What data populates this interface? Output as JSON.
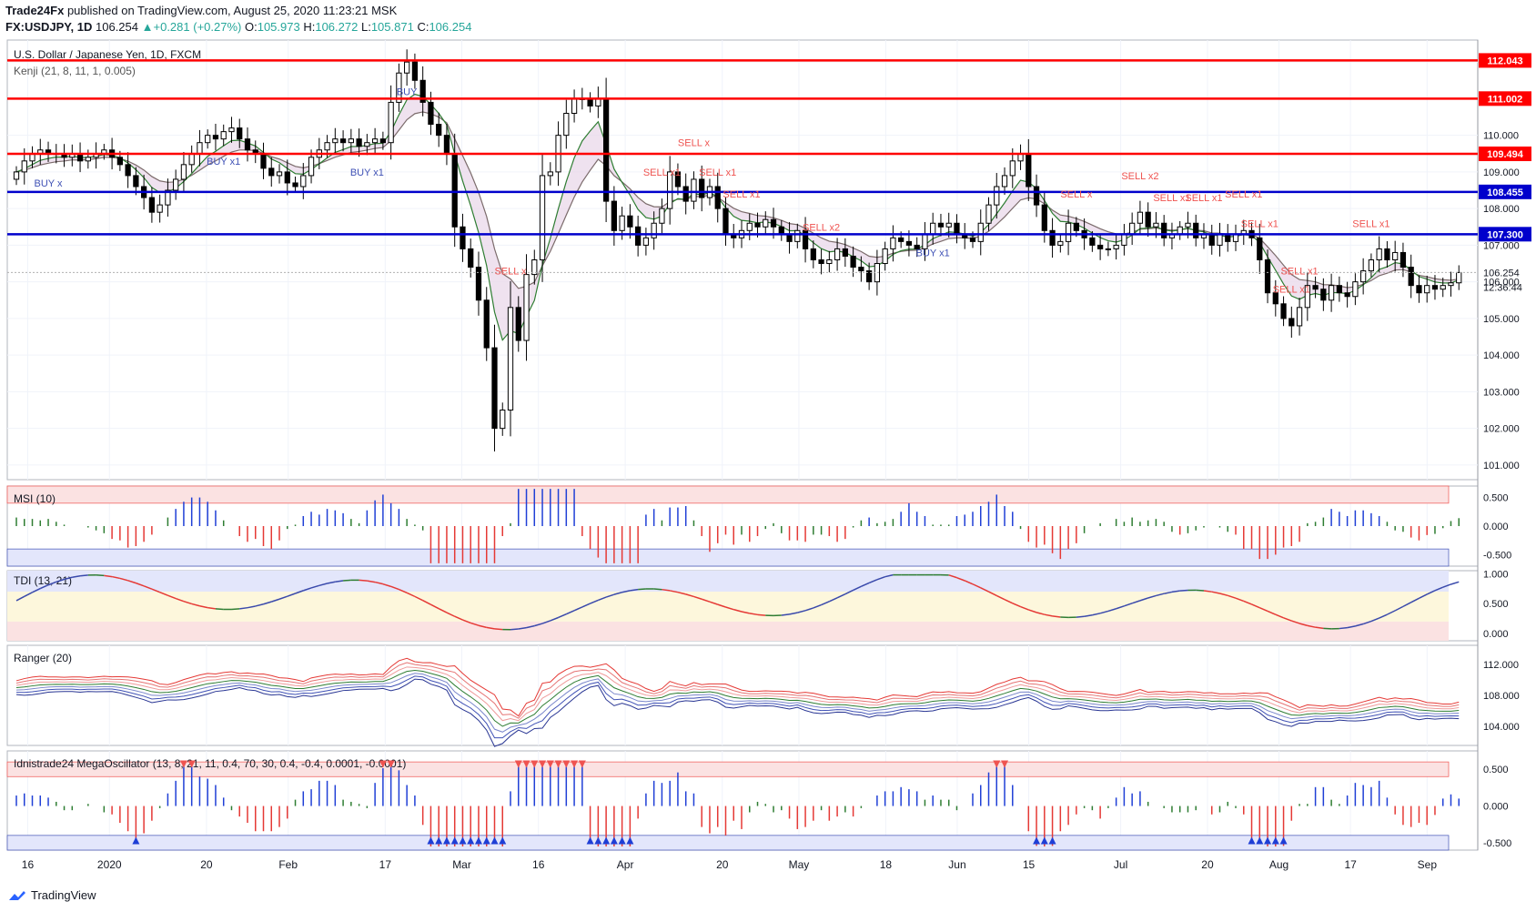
{
  "header": {
    "publisher": "Trade24Fx",
    "published_text": "published on TradingView.com, August 25, 2020 11:23:21 MSK",
    "symbol": "FX:USDJPY, 1D",
    "last": "106.254",
    "change": "+0.281 (+0.27%)",
    "o_label": "O:",
    "o": "105.973",
    "h_label": "H:",
    "h": "106.272",
    "l_label": "L:",
    "l": "105.871",
    "c_label": "C:",
    "c": "106.254"
  },
  "brand": "TradingView",
  "colors": {
    "bull": "#26a69a",
    "bear": "#ef5350",
    "red_level": "#ff0000",
    "blue_level": "#0000cc",
    "buy": "#3f51b5",
    "sell": "#ef5350"
  },
  "chart_data": [
    {
      "type": "candlestick",
      "title": "U.S. Dollar / Japanese Yen, 1D, FXCM",
      "subtitle": "Kenji (21, 8, 11, 1, 0.005)",
      "ylim": [
        100.6,
        112.6
      ],
      "y_ticks": [
        "112.000",
        "111.000",
        "110.000",
        "109.000",
        "108.000",
        "107.000",
        "106.000",
        "105.000",
        "104.000",
        "103.000",
        "102.000",
        "101.000"
      ],
      "y_tick_values": [
        112,
        111,
        110,
        109,
        108,
        107,
        106,
        105,
        104,
        103,
        102,
        101
      ],
      "x_ticks": [
        "16",
        "2020",
        "20",
        "Feb",
        "17",
        "Mar",
        "16",
        "Apr",
        "20",
        "May",
        "18",
        "Jun",
        "15",
        "Jul",
        "20",
        "Aug",
        "17",
        "Sep"
      ],
      "x_tick_days": [
        0,
        16,
        35,
        51,
        70,
        85,
        100,
        117,
        136,
        151,
        168,
        182,
        196,
        214,
        231,
        245,
        259,
        274
      ],
      "horizontal_levels": [
        {
          "value": 112.043,
          "label": "112.043",
          "color": "red"
        },
        {
          "value": 111.002,
          "label": "111.002",
          "color": "red"
        },
        {
          "value": 109.494,
          "label": "109.494",
          "color": "red"
        },
        {
          "value": 108.455,
          "label": "108.455",
          "color": "blue"
        },
        {
          "value": 107.3,
          "label": "107.300",
          "color": "blue"
        }
      ],
      "last_price": "106.254",
      "countdown": "12:36:44",
      "close_series": [
        109.0,
        109.3,
        109.5,
        109.6,
        109.5,
        109.5,
        109.4,
        109.5,
        109.3,
        109.4,
        109.5,
        109.6,
        109.4,
        109.2,
        108.9,
        108.6,
        108.3,
        107.9,
        108.1,
        108.5,
        108.8,
        109.2,
        109.5,
        109.8,
        110.0,
        109.9,
        110.1,
        110.2,
        109.9,
        109.6,
        109.5,
        109.1,
        108.9,
        109.0,
        108.7,
        108.6,
        108.9,
        109.4,
        109.6,
        109.8,
        109.9,
        109.8,
        109.9,
        109.7,
        109.8,
        109.9,
        109.8,
        110.9,
        111.7,
        112.0,
        111.5,
        110.9,
        110.3,
        110.0,
        109.5,
        107.5,
        106.9,
        106.4,
        105.5,
        104.2,
        102.0,
        102.5,
        105.3,
        104.4,
        106.2,
        106.6,
        108.9,
        109.0,
        110.0,
        110.6,
        111.0,
        111.0,
        110.8,
        111.0,
        108.2,
        107.4,
        107.8,
        107.5,
        107.0,
        107.2,
        107.6,
        108.0,
        109.0,
        108.6,
        108.2,
        108.8,
        108.3,
        108.6,
        108.0,
        107.3,
        107.2,
        107.4,
        107.6,
        107.5,
        107.7,
        107.5,
        107.3,
        107.1,
        107.4,
        106.9,
        106.6,
        106.5,
        106.6,
        106.9,
        106.7,
        106.4,
        106.3,
        106.0,
        106.5,
        106.9,
        107.2,
        107.1,
        107.0,
        106.9,
        107.3,
        107.6,
        107.5,
        107.6,
        107.3,
        107.2,
        107.1,
        107.6,
        108.1,
        108.6,
        108.9,
        109.3,
        109.5,
        108.6,
        108.1,
        107.4,
        107.0,
        107.1,
        107.6,
        107.4,
        107.2,
        107.0,
        106.9,
        106.9,
        107.0,
        107.3,
        107.6,
        107.9,
        107.5,
        107.6,
        107.2,
        107.3,
        107.5,
        107.6,
        107.2,
        107.3,
        107.0,
        107.3,
        107.1,
        107.3,
        107.4,
        107.2,
        106.6,
        105.7,
        105.4,
        105.0,
        104.8,
        105.3,
        105.9,
        105.8,
        105.5,
        105.9,
        105.7,
        105.6,
        106.0,
        106.3,
        106.6,
        106.9,
        106.6,
        106.8,
        106.4,
        105.9,
        105.7,
        105.9,
        105.8,
        105.9,
        105.973,
        106.254
      ]
    },
    {
      "type": "bar",
      "title": "MSI (10)",
      "ylim": [
        -0.7,
        0.7
      ],
      "y_ticks": [
        "0.500",
        "0.000",
        "-0.500"
      ],
      "y_tick_values": [
        0.5,
        0,
        -0.5
      ],
      "upper_band": [
        0.4,
        0.7
      ],
      "lower_band": [
        -0.7,
        -0.4
      ]
    },
    {
      "type": "line",
      "title": "TDI (13, 21)",
      "ylim": [
        -0.12,
        1.05
      ],
      "y_ticks": [
        "1.000",
        "0.500",
        "0.000"
      ],
      "y_tick_values": [
        1,
        0.5,
        0
      ],
      "upper_band": [
        0.7,
        1.05
      ],
      "lower_band": [
        -0.12,
        0.2
      ]
    },
    {
      "type": "line",
      "title": "Ranger (20)",
      "ylim": [
        101.5,
        114.5
      ],
      "y_ticks": [
        "112.000",
        "108.000",
        "104.000"
      ],
      "y_tick_values": [
        112,
        108,
        104
      ]
    },
    {
      "type": "bar",
      "title": "Idnistrade24 MegaOscillator (13, 8, 21, 11, 0.4, 70, 30, 0.4, -0.4, 0.0001, -0.0001)",
      "ylim": [
        -0.6,
        0.75
      ],
      "y_ticks": [
        "0.500",
        "0.000",
        "-0.500"
      ],
      "y_tick_values": [
        0.5,
        0,
        -0.5
      ],
      "upper_band": [
        0.4,
        0.6
      ],
      "lower_band": [
        -0.6,
        -0.4
      ]
    }
  ],
  "signals": [
    {
      "text": "BUY x",
      "day": 6,
      "side": "buy"
    },
    {
      "text": "BUY x1",
      "day": 40,
      "side": "buy"
    },
    {
      "text": "BUY x1",
      "day": 69,
      "side": "buy"
    },
    {
      "text": "BUY",
      "day": 76,
      "side": "buy"
    },
    {
      "text": "SELL x",
      "day": 97,
      "side": "sell"
    },
    {
      "text": "SELL x1",
      "day": 126,
      "side": "sell"
    },
    {
      "text": "SELL x",
      "day": 132,
      "side": "sell"
    },
    {
      "text": "SELL x1",
      "day": 137,
      "side": "sell"
    },
    {
      "text": "SELL x1",
      "day": 142,
      "side": "sell"
    },
    {
      "text": "SELL x2",
      "day": 158,
      "side": "sell"
    },
    {
      "text": "BUY x1",
      "day": 180,
      "side": "buy"
    },
    {
      "text": "SELL x",
      "day": 208,
      "side": "sell"
    },
    {
      "text": "SELL x2",
      "day": 220,
      "side": "sell"
    },
    {
      "text": "SELL x1",
      "day": 226,
      "side": "sell"
    },
    {
      "text": "SELL x1",
      "day": 232,
      "side": "sell"
    },
    {
      "text": "SELL x1",
      "day": 240,
      "side": "sell"
    },
    {
      "text": "SELL x1",
      "day": 243,
      "side": "sell"
    },
    {
      "text": "SELL x1",
      "day": 249,
      "side": "sell"
    },
    {
      "text": "SELL x1",
      "day": 251,
      "side": "sell"
    },
    {
      "text": "SELL x1",
      "day": 265,
      "side": "sell"
    }
  ]
}
